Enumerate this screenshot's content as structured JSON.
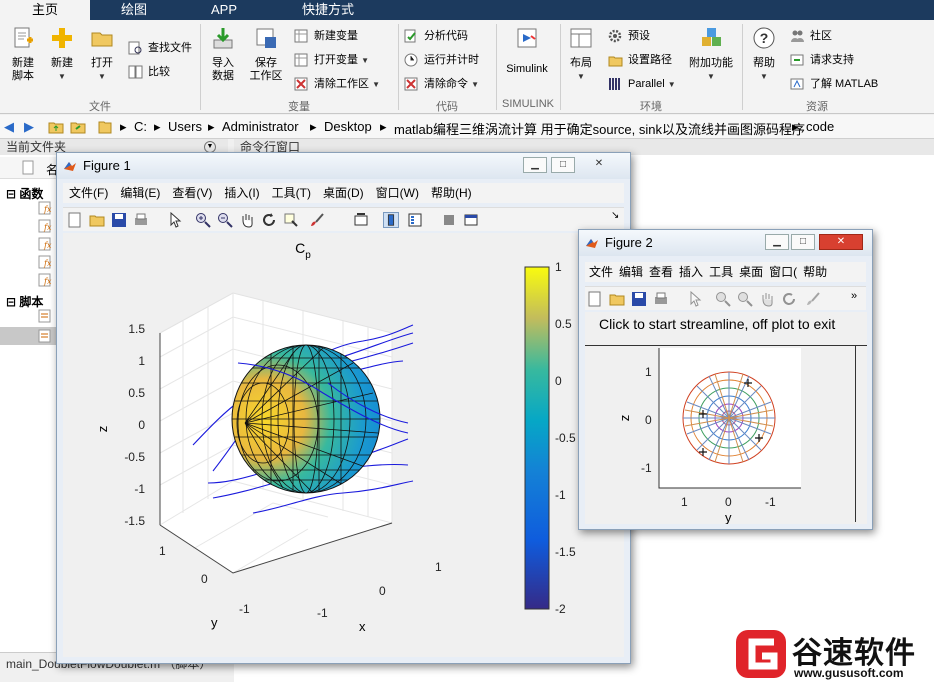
{
  "tabs": [
    "主页",
    "绘图",
    "APP",
    "快捷方式"
  ],
  "ribbon": {
    "new_script": "新建\n脚本",
    "new": "新建",
    "open": "打开",
    "find_files": "查找文件",
    "compare": "比较",
    "import_data": "导入\n数据",
    "save_workspace": "保存\n工作区",
    "new_variable": "新建变量",
    "open_variable": "打开变量",
    "clear_workspace": "清除工作区",
    "analyze_code": "分析代码",
    "run_and_time": "运行并计时",
    "clear_commands": "清除命令",
    "simulink": "Simulink",
    "layout": "布局",
    "preferences": "预设",
    "set_path": "设置路径",
    "parallel": "Parallel",
    "addons": "附加功能",
    "help": "帮助",
    "community": "社区",
    "request_support": "请求支持",
    "learn_matlab": "了解 MATLAB",
    "groups": [
      "文件",
      "变量",
      "代码",
      "SIMULINK",
      "环境",
      "资源"
    ]
  },
  "address": {
    "crumbs": [
      "C:",
      "Users",
      "Administrator",
      "Desktop",
      "matlab编程三维涡流计算 用于确定source, sink以及流线并画图源码程序",
      "code"
    ]
  },
  "left_panel": {
    "title": "当前文件夹",
    "name_header": "名",
    "functions_label": "函数",
    "scripts_label": "脚本",
    "footer_file": "main_DoubletFlowDoublet.m （脚本）"
  },
  "command_window": {
    "title": "命令行窗口"
  },
  "figure1": {
    "title": "Figure 1",
    "menu": [
      "文件(F)",
      "编辑(E)",
      "查看(V)",
      "插入(I)",
      "工具(T)",
      "桌面(D)",
      "窗口(W)",
      "帮助(H)"
    ],
    "plot_title": "C",
    "plot_title_sub": "p",
    "xlabel": "x",
    "ylabel": "y",
    "zlabel": "z",
    "z_ticks": [
      "1.5",
      "1",
      "0.5",
      "0",
      "-0.5",
      "-1",
      "-1.5"
    ],
    "x_ticks": [
      "1",
      "0",
      "-1"
    ],
    "y_ticks": [
      "1",
      "0",
      "-1"
    ],
    "colorbar_ticks": [
      "1",
      "0.5",
      "0",
      "-0.5",
      "-1",
      "-1.5",
      "-2"
    ]
  },
  "figure2": {
    "title": "Figure 2",
    "menu": [
      "文件",
      "编辑",
      "查看",
      "插入",
      "工具",
      "桌面",
      "窗口(",
      "帮助"
    ],
    "message": "Click to start streamline, off plot to exit",
    "xlabel": "y",
    "ylabel": "z",
    "y_ticks": [
      "1",
      "0",
      "-1"
    ],
    "x_ticks": [
      "1",
      "0",
      "-1"
    ]
  },
  "watermark": {
    "brand": "谷速软件",
    "url": "www.gususoft.com"
  },
  "colors": {
    "tabbar": "#1c3a5e",
    "accent": "#e0242a",
    "colormap_top": "#f9fb0e",
    "colormap_bottom": "#352a87"
  }
}
